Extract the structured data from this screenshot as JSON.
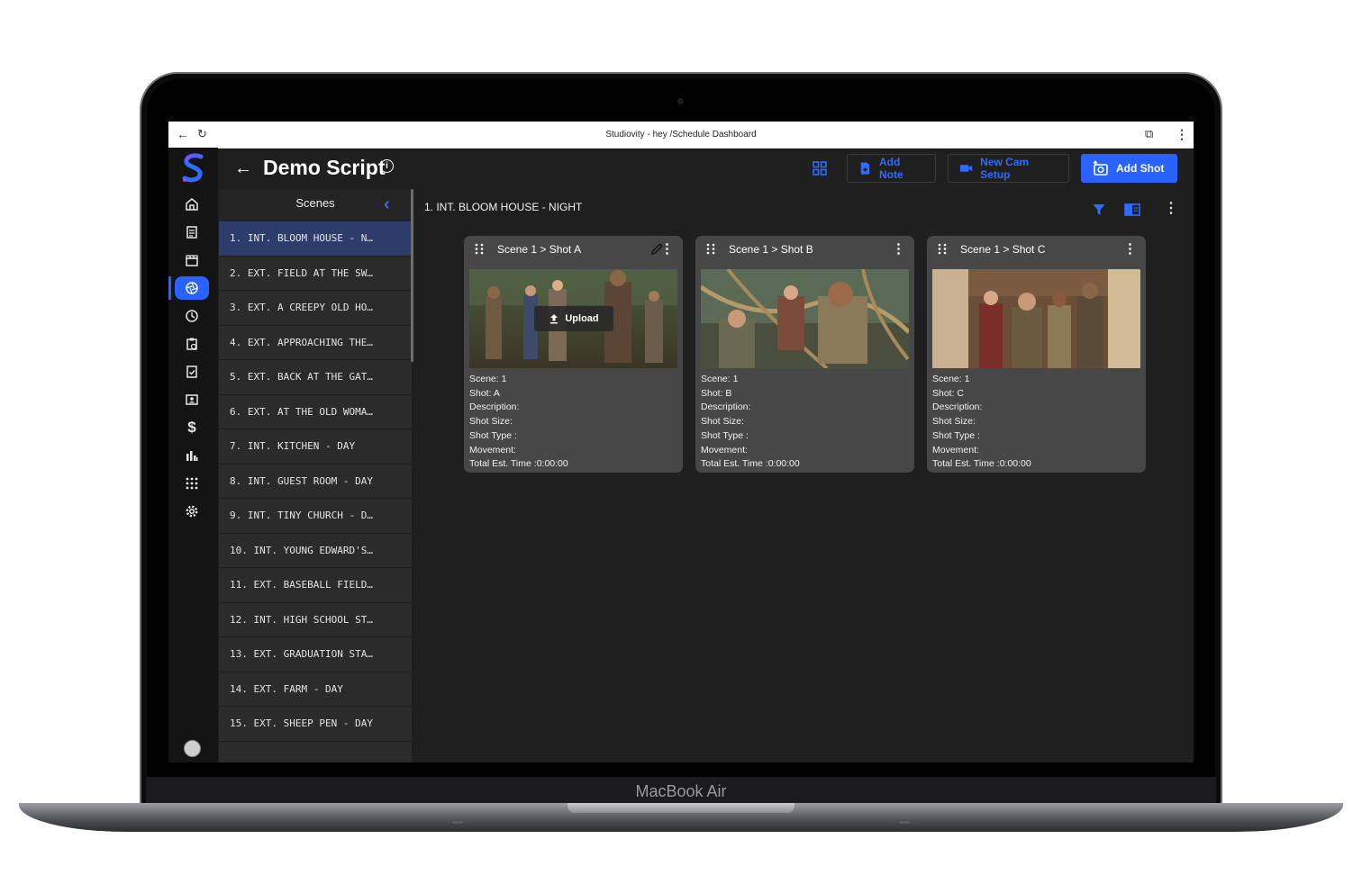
{
  "device": {
    "brand": "MacBook Air"
  },
  "browser": {
    "title": "Studiovity - hey /Schedule Dashboard"
  },
  "nav": {
    "items": [
      "home",
      "script",
      "scenes",
      "shots",
      "schedule",
      "callsheet",
      "tasks",
      "contacts",
      "budget",
      "reports",
      "apps",
      "settings"
    ],
    "active": "shots"
  },
  "header": {
    "title": "Demo Script",
    "add_note": "Add Note",
    "new_cam_setup": "New Cam Setup",
    "add_shot": "Add Shot"
  },
  "scenes_panel": {
    "title": "Scenes",
    "items": [
      "1. INT. BLOOM HOUSE - N…",
      "2. EXT. FIELD AT THE SW…",
      "3. EXT. A CREEPY OLD HO…",
      "4. EXT. APPROACHING THE…",
      "5. EXT. BACK AT THE GAT…",
      "6. EXT. AT THE OLD WOMA…",
      "7. INT. KITCHEN - DAY",
      "8. INT. GUEST ROOM - DAY",
      "9. INT. TINY CHURCH - D…",
      "10. INT. YOUNG EDWARD'S…",
      "11. EXT. BASEBALL FIELD…",
      "12. INT. HIGH SCHOOL ST…",
      "13. EXT. GRADUATION STA…",
      "14. EXT. FARM - DAY",
      "15. EXT. SHEEP PEN - DAY"
    ],
    "selected_index": 0
  },
  "main": {
    "scene_heading": "1. INT. BLOOM HOUSE - NIGHT",
    "upload_label": "Upload",
    "cards": [
      {
        "title": "Scene 1 > Shot A",
        "scene": "Scene: 1",
        "shot": "Shot: A",
        "description": "Description:",
        "shot_size": "Shot Size:",
        "shot_type": "Shot Type :",
        "movement": "Movement:",
        "total_time": "Total Est. Time :0:00:00"
      },
      {
        "title": "Scene 1 > Shot B",
        "scene": "Scene: 1",
        "shot": "Shot: B",
        "description": "Description:",
        "shot_size": "Shot Size:",
        "shot_type": "Shot Type :",
        "movement": "Movement:",
        "total_time": "Total Est. Time :0:00:00"
      },
      {
        "title": "Scene 1 > Shot C",
        "scene": "Scene: 1",
        "shot": "Shot: C",
        "description": "Description:",
        "shot_size": "Shot Size:",
        "shot_type": "Shot Type :",
        "movement": "Movement:",
        "total_time": "Total Est. Time :0:00:00"
      }
    ]
  },
  "colors": {
    "accent": "#2962ff",
    "background": "#1f1f1f",
    "card": "#474747",
    "panel": "#2b2b2b"
  }
}
